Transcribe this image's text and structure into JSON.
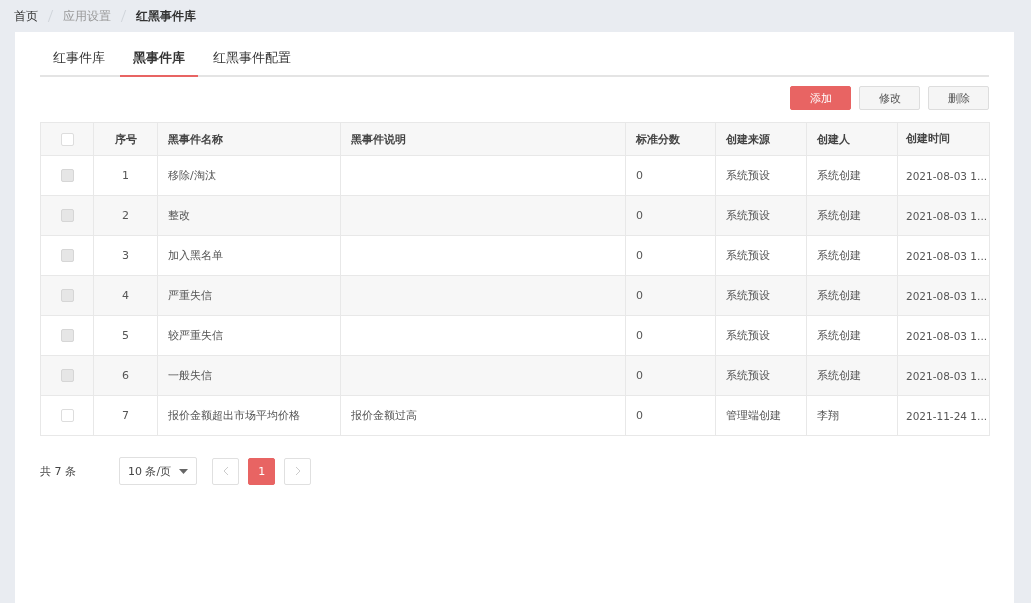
{
  "breadcrumb": [
    {
      "label": "首页",
      "kind": "link"
    },
    {
      "label": "应用设置",
      "kind": "muted"
    },
    {
      "label": "红黑事件库",
      "kind": "current"
    }
  ],
  "tabs": [
    {
      "label": "红事件库",
      "selected": false
    },
    {
      "label": "黑事件库",
      "selected": true
    },
    {
      "label": "红黑事件配置",
      "selected": false
    }
  ],
  "buttons": [
    {
      "label": "添加",
      "kind": "primary"
    },
    {
      "label": "修改",
      "kind": "default"
    },
    {
      "label": "删除",
      "kind": "default"
    }
  ],
  "table": {
    "header_checkbox": {
      "checked": false
    },
    "columns": [
      "序号",
      "黑事件名称",
      "黑事件说明",
      "标准分数",
      "创建来源",
      "创建人",
      "创建时间"
    ],
    "rows": [
      {
        "checked": false,
        "disabled": true,
        "cells": [
          "1",
          "移除/淘汰",
          "",
          "0",
          "系统预设",
          "系统创建",
          "2021-08-03 1..."
        ]
      },
      {
        "checked": false,
        "disabled": true,
        "cells": [
          "2",
          "整改",
          "",
          "0",
          "系统预设",
          "系统创建",
          "2021-08-03 1..."
        ]
      },
      {
        "checked": false,
        "disabled": true,
        "cells": [
          "3",
          "加入黑名单",
          "",
          "0",
          "系统预设",
          "系统创建",
          "2021-08-03 1..."
        ]
      },
      {
        "checked": false,
        "disabled": true,
        "cells": [
          "4",
          "严重失信",
          "",
          "0",
          "系统预设",
          "系统创建",
          "2021-08-03 1..."
        ]
      },
      {
        "checked": false,
        "disabled": true,
        "cells": [
          "5",
          "较严重失信",
          "",
          "0",
          "系统预设",
          "系统创建",
          "2021-08-03 1..."
        ]
      },
      {
        "checked": false,
        "disabled": true,
        "cells": [
          "6",
          "一般失信",
          "",
          "0",
          "系统预设",
          "系统创建",
          "2021-08-03 1..."
        ]
      },
      {
        "checked": false,
        "disabled": false,
        "cells": [
          "7",
          "报价金额超出市场平均价格",
          "报价金额过高",
          "0",
          "管理端创建",
          "李翔",
          "2021-11-24 1..."
        ]
      }
    ]
  },
  "pagination": {
    "total": "共 7 条",
    "page_size": "10 条/页",
    "pages": [
      {
        "label": "1",
        "selected": true
      }
    ]
  }
}
